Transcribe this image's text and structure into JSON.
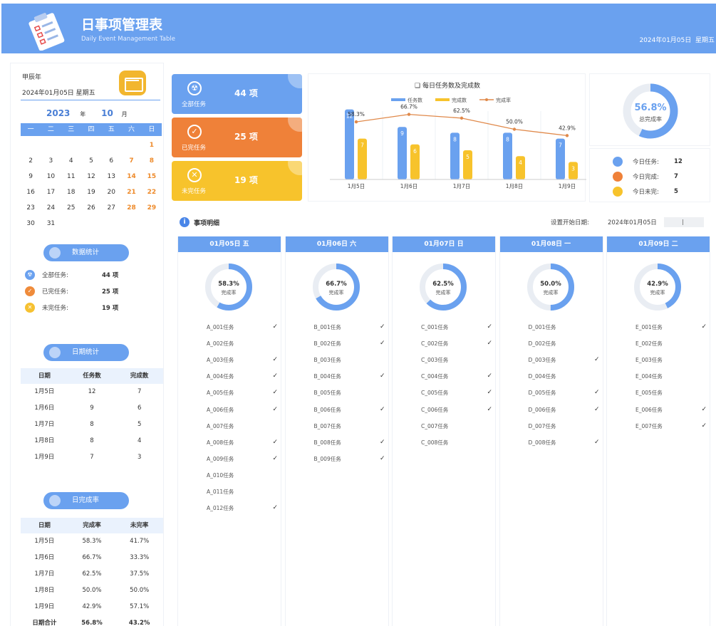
{
  "header": {
    "title": "日事项管理表",
    "subtitle": "Daily Event Management Table",
    "date": "2024年01月05日",
    "weekday": "星期五"
  },
  "sidebar": {
    "lunar": "甲辰年",
    "today": "2024年01月05日  星期五",
    "year": "2023",
    "year_unit": "年",
    "month": "10",
    "month_unit": "月",
    "weekdays": [
      "一",
      "二",
      "三",
      "四",
      "五",
      "六",
      "日"
    ],
    "calendar": [
      [
        "",
        "",
        "",
        "",
        "",
        "",
        "1"
      ],
      [
        "2",
        "3",
        "4",
        "5",
        "6",
        "7",
        "8"
      ],
      [
        "9",
        "10",
        "11",
        "12",
        "13",
        "14",
        "15"
      ],
      [
        "16",
        "17",
        "18",
        "19",
        "20",
        "21",
        "22"
      ],
      [
        "23",
        "24",
        "25",
        "26",
        "27",
        "28",
        "29"
      ],
      [
        "30",
        "31",
        "",
        "",
        "",
        "",
        ""
      ]
    ],
    "stats_title": "数据统计",
    "stats": [
      {
        "label": "全部任务:",
        "value": "44 项",
        "color": "#6aa1ef",
        "icon": "radiation-icon"
      },
      {
        "label": "已完任务:",
        "value": "25 项",
        "color": "#ef8b3b",
        "icon": "check-icon"
      },
      {
        "label": "未完任务:",
        "value": "19 项",
        "color": "#f6c131",
        "icon": "close-icon"
      }
    ],
    "date_stats_title": "日期统计",
    "date_stats_headers": [
      "日期",
      "任务数",
      "完成数"
    ],
    "date_stats": [
      [
        "1月5日",
        "12",
        "7"
      ],
      [
        "1月6日",
        "9",
        "6"
      ],
      [
        "1月7日",
        "8",
        "5"
      ],
      [
        "1月8日",
        "8",
        "4"
      ],
      [
        "1月9日",
        "7",
        "3"
      ]
    ],
    "rate_title": "日完成率",
    "rate_headers": [
      "日期",
      "完成率",
      "未完率"
    ],
    "rate_rows": [
      [
        "1月5日",
        "58.3%",
        "41.7%"
      ],
      [
        "1月6日",
        "66.7%",
        "33.3%"
      ],
      [
        "1月7日",
        "62.5%",
        "37.5%"
      ],
      [
        "1月8日",
        "50.0%",
        "50.0%"
      ],
      [
        "1月9日",
        "42.9%",
        "57.1%"
      ],
      [
        "日期合计",
        "56.8%",
        "43.2%"
      ]
    ]
  },
  "cards": [
    {
      "label": "全部任务",
      "value": "44 项",
      "color": "#6aa1ef",
      "icon": "☢"
    },
    {
      "label": "已完任务",
      "value": "25 项",
      "color": "#ef8139",
      "icon": "✓"
    },
    {
      "label": "未完任务",
      "value": "19 项",
      "color": "#f7c32c",
      "icon": "✕"
    }
  ],
  "chart_data": {
    "type": "bar",
    "title": "每日任务数及完成数",
    "categories": [
      "1月5日",
      "1月6日",
      "1月7日",
      "1月8日",
      "1月9日"
    ],
    "series": [
      {
        "name": "任务数",
        "values": [
          12,
          9,
          8,
          8,
          7
        ],
        "color": "#6aa1ef"
      },
      {
        "name": "完成数",
        "values": [
          7,
          6,
          5,
          4,
          3
        ],
        "color": "#f7c32c"
      },
      {
        "name": "完成率",
        "type": "line",
        "values": [
          58.3,
          66.7,
          62.5,
          50.0,
          42.9
        ],
        "labels": [
          "58.3%",
          "66.7%",
          "62.5%",
          "50.0%",
          "42.9%"
        ],
        "color": "#e0894a"
      }
    ]
  },
  "overall": {
    "rate": "56.8%",
    "rate_value": 56.8,
    "label": "总完成率"
  },
  "today_stats": [
    {
      "label": "今日任务:",
      "value": "12",
      "color": "#6aa1ef"
    },
    {
      "label": "今日完成:",
      "value": "7",
      "color": "#ef8139"
    },
    {
      "label": "今日未完:",
      "value": "5",
      "color": "#f7c32c"
    }
  ],
  "detail": {
    "title": "事项明细",
    "set_label": "设置开始日期:",
    "set_value": "2024年01月05日"
  },
  "days": [
    {
      "header": "01月05日  五",
      "rate": "58.3%",
      "rate_value": 58.3,
      "rate_label": "完成率",
      "tasks": [
        {
          "name": "A_001任务",
          "done": true
        },
        {
          "name": "A_002任务",
          "done": false
        },
        {
          "name": "A_003任务",
          "done": true
        },
        {
          "name": "A_004任务",
          "done": true
        },
        {
          "name": "A_005任务",
          "done": true
        },
        {
          "name": "A_006任务",
          "done": true
        },
        {
          "name": "A_007任务",
          "done": false
        },
        {
          "name": "A_008任务",
          "done": true
        },
        {
          "name": "A_009任务",
          "done": true
        },
        {
          "name": "A_010任务",
          "done": false
        },
        {
          "name": "A_011任务",
          "done": false
        },
        {
          "name": "A_012任务",
          "done": true
        }
      ]
    },
    {
      "header": "01月06日  六",
      "rate": "66.7%",
      "rate_value": 66.7,
      "rate_label": "完成率",
      "tasks": [
        {
          "name": "B_001任务",
          "done": true
        },
        {
          "name": "B_002任务",
          "done": true
        },
        {
          "name": "B_003任务",
          "done": false
        },
        {
          "name": "B_004任务",
          "done": true
        },
        {
          "name": "B_005任务",
          "done": false
        },
        {
          "name": "B_006任务",
          "done": true
        },
        {
          "name": "B_007任务",
          "done": false
        },
        {
          "name": "B_008任务",
          "done": true
        },
        {
          "name": "B_009任务",
          "done": true
        }
      ]
    },
    {
      "header": "01月07日  日",
      "rate": "62.5%",
      "rate_value": 62.5,
      "rate_label": "完成率",
      "tasks": [
        {
          "name": "C_001任务",
          "done": true
        },
        {
          "name": "C_002任务",
          "done": true
        },
        {
          "name": "C_003任务",
          "done": false
        },
        {
          "name": "C_004任务",
          "done": true
        },
        {
          "name": "C_005任务",
          "done": true
        },
        {
          "name": "C_006任务",
          "done": true
        },
        {
          "name": "C_007任务",
          "done": false
        },
        {
          "name": "C_008任务",
          "done": false
        }
      ]
    },
    {
      "header": "01月08日  一",
      "rate": "50.0%",
      "rate_value": 50.0,
      "rate_label": "完成率",
      "tasks": [
        {
          "name": "D_001任务",
          "done": false
        },
        {
          "name": "D_002任务",
          "done": false
        },
        {
          "name": "D_003任务",
          "done": true
        },
        {
          "name": "D_004任务",
          "done": false
        },
        {
          "name": "D_005任务",
          "done": true
        },
        {
          "name": "D_006任务",
          "done": true
        },
        {
          "name": "D_007任务",
          "done": false
        },
        {
          "name": "D_008任务",
          "done": true
        }
      ]
    },
    {
      "header": "01月09日  二",
      "rate": "42.9%",
      "rate_value": 42.9,
      "rate_label": "完成率",
      "tasks": [
        {
          "name": "E_001任务",
          "done": true
        },
        {
          "name": "E_002任务",
          "done": false
        },
        {
          "name": "E_003任务",
          "done": false
        },
        {
          "name": "E_004任务",
          "done": false
        },
        {
          "name": "E_005任务",
          "done": false
        },
        {
          "name": "E_006任务",
          "done": true
        },
        {
          "name": "E_007任务",
          "done": true
        }
      ]
    }
  ],
  "checkmark": "✓"
}
